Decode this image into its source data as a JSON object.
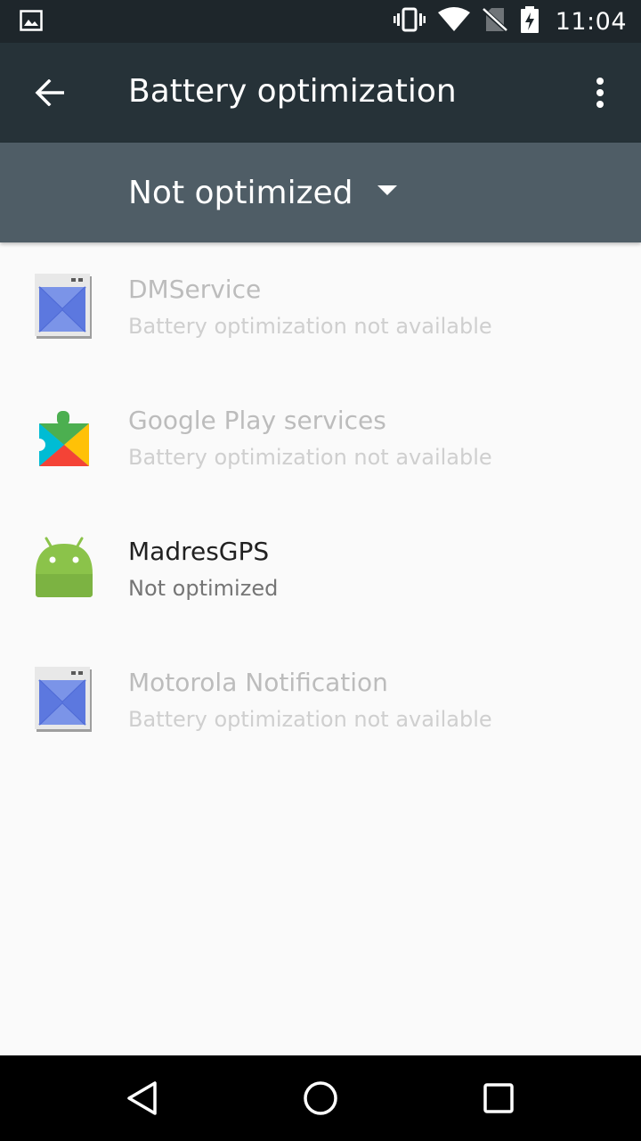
{
  "status_bar": {
    "time": "11:04",
    "icons": [
      "image-icon",
      "vibrate-icon",
      "wifi-icon",
      "no-sim-icon",
      "battery-charging-icon"
    ]
  },
  "toolbar": {
    "title": "Battery optimization",
    "back_icon": "arrow-back-icon",
    "more_icon": "more-vert-icon"
  },
  "filter": {
    "selected": "Not optimized",
    "icon": "dropdown-arrow-icon"
  },
  "apps": [
    {
      "name": "DMService",
      "status": "Battery optimization not available",
      "icon": "default-app-icon",
      "enabled": false
    },
    {
      "name": "Google Play services",
      "status": "Battery optimization not available",
      "icon": "play-services-icon",
      "enabled": false
    },
    {
      "name": "MadresGPS",
      "status": "Not optimized",
      "icon": "android-icon",
      "enabled": true
    },
    {
      "name": "Motorola Notification",
      "status": "Battery optimization not available",
      "icon": "default-app-icon",
      "enabled": false
    }
  ],
  "nav_bar": {
    "back_icon": "nav-back-icon",
    "home_icon": "nav-home-icon",
    "recents_icon": "nav-recents-icon"
  },
  "colors": {
    "status_bar": "#1e262b",
    "toolbar": "#263238",
    "filter_bar": "#4f5d66",
    "background": "#fafafa"
  }
}
